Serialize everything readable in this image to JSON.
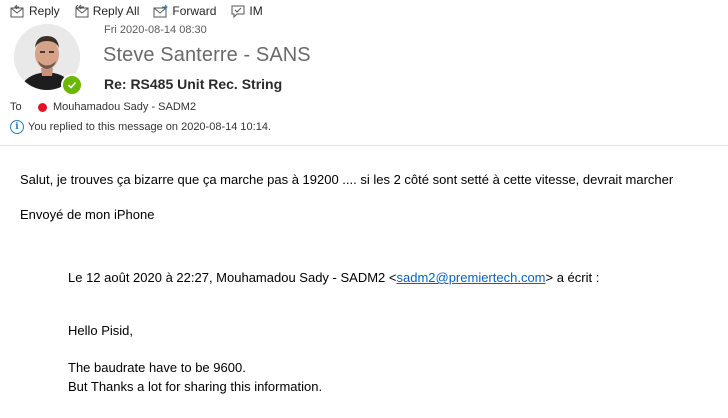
{
  "toolbar": {
    "reply_label": "Reply",
    "reply_all_label": "Reply All",
    "forward_label": "Forward",
    "im_label": "IM"
  },
  "header": {
    "date": "Fri 2020-08-14 08:30",
    "sender": "Steve Santerre - SANS",
    "subject": "Re: RS485 Unit Rec. String",
    "to_label": "To",
    "to_name": "Mouhamadou Sady - SADM2",
    "info": "You replied to this message on 2020-08-14 10:14."
  },
  "body": {
    "line1": "Salut, je trouves ça bizarre que ça marche pas à 19200 .... si les 2 côté sont setté à cette vitesse, devrait marcher",
    "signature": "Envoyé de mon iPhone",
    "quote_prefix": "Le 12 août 2020 à 22:27, Mouhamadou Sady - SADM2 <",
    "quote_email": "sadm2@premiertech.com",
    "quote_suffix": "> a écrit :",
    "greeting": "Hello Pisid,",
    "quote_line1": "The baudrate have to be 9600.",
    "quote_line2": "But Thanks a lot for sharing this information."
  },
  "colors": {
    "presence": "#6bb700",
    "recipient_status": "#e81123",
    "link": "#0563c1"
  }
}
